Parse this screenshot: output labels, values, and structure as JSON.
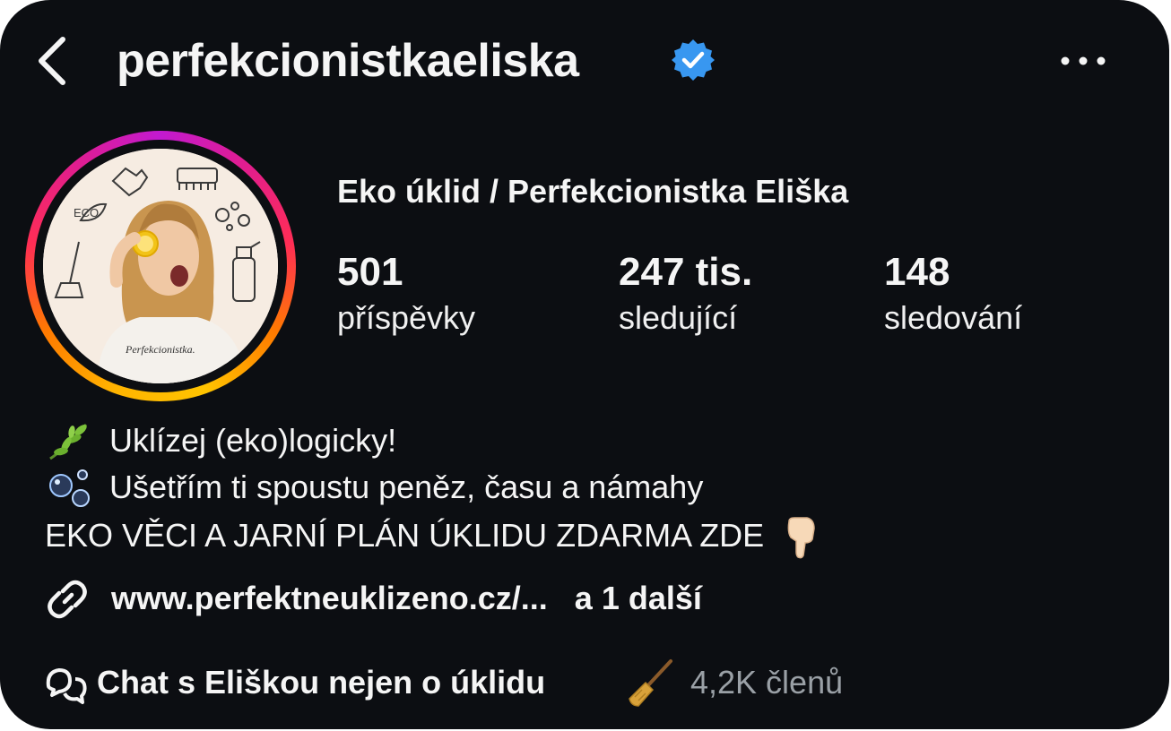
{
  "header": {
    "username": "perfekcionistkaeliska",
    "back_icon": "chevron-left-icon",
    "verified_icon": "verified-badge-icon",
    "more_icon": "more-horizontal-icon"
  },
  "profile": {
    "full_name": "Eko úklid / Perfekcionistka Eliška",
    "avatar_text": "ECO",
    "shirt_text": "Perfekcionistka.",
    "stats": [
      {
        "value": "501",
        "label": "příspěvky"
      },
      {
        "value": "247 tis.",
        "label": "sledující"
      },
      {
        "value": "148",
        "label": "sledování"
      }
    ]
  },
  "bio": {
    "lines": [
      {
        "emoji": "herb-emoji",
        "text": "Uklízej (eko)logicky!"
      },
      {
        "emoji": "bubbles-emoji",
        "text": "Ušetřím ti spoustu peněz, času a námahy"
      },
      {
        "text": "EKO VĚCI A JARNÍ PLÁN ÚKLIDU ZDARMA ZDE",
        "emoji": "pointing-down-emoji"
      }
    ],
    "link": {
      "url": "www.perfektneuklizeno.cz/...",
      "more": "a 1 další",
      "icon": "link-icon"
    },
    "channel": {
      "title": "Chat s Eliškou nejen o úklidu",
      "emoji": "broom-emoji",
      "members": "4,2K členů",
      "icon": "chat-bubbles-icon"
    }
  },
  "colors": {
    "background": "#0c0e12",
    "text": "#f5f5f5",
    "muted": "#9aa0a6",
    "verified": "#3897f0",
    "ring_start": "#ffb400",
    "ring_end": "#c21ad0"
  }
}
